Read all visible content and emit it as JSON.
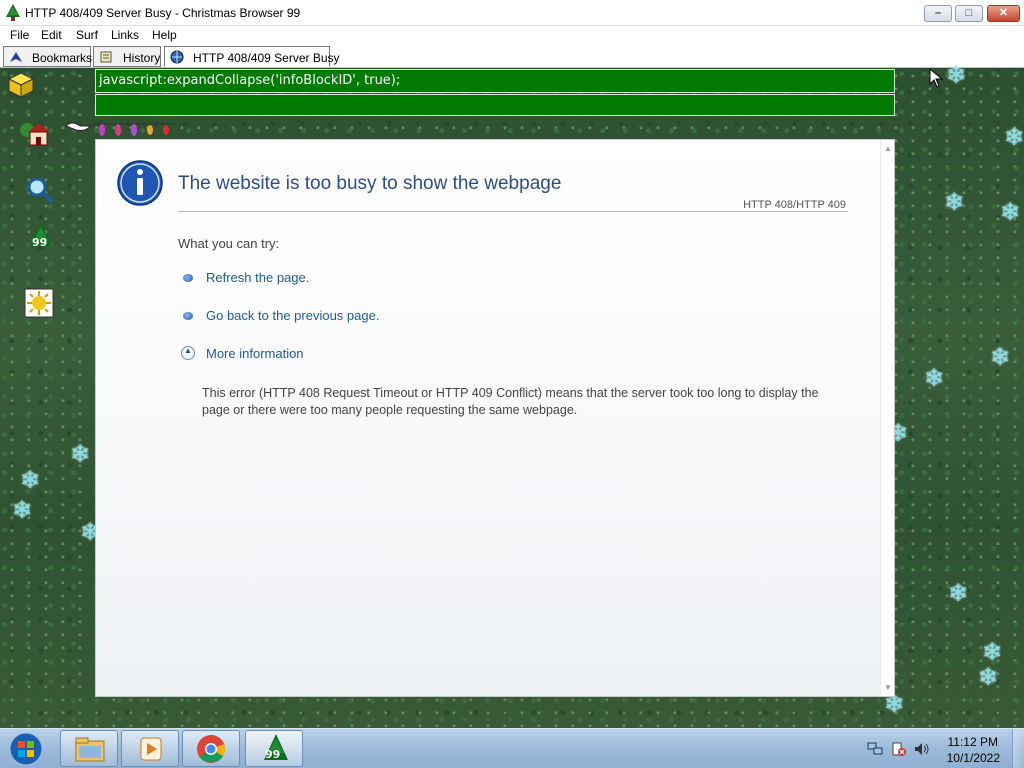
{
  "window": {
    "title": "HTTP 408/409 Server Busy - Christmas Browser 99",
    "controls": {
      "minimize": "–",
      "maximize": "□",
      "close": "✕"
    }
  },
  "menu": {
    "items": [
      "File",
      "Edit",
      "Surf",
      "Links",
      "Help"
    ]
  },
  "tabs": {
    "bookmarks": "Bookmarks",
    "history": "History",
    "active": "HTTP 408/409 Server Busy"
  },
  "address_bar": {
    "value": "javascript:expandCollapse('infoBlockID', true);"
  },
  "page": {
    "heading": "The website is too busy to show the webpage",
    "error_code": "HTTP 408/HTTP 409",
    "try_label": "What you can try:",
    "links": {
      "refresh": "Refresh the page.",
      "go_back": "Go back to the previous page.",
      "more_info": "More information"
    },
    "details": "This error (HTTP 408 Request Timeout or HTTP 409 Conflict) means that the server took too long to display the page or there were too many people requesting the same webpage."
  },
  "sidebar": {
    "items": [
      "box-icon",
      "home-icon",
      "search-icon",
      "tree-99-icon",
      "sun-icon"
    ],
    "tree_badge": "99"
  },
  "taskbar": {
    "clock_time": "11:12 PM",
    "clock_date": "10/1/2022",
    "christmas_badge": "99"
  },
  "colors": {
    "address_bg": "#007a00",
    "heading": "#2a4f86",
    "link": "#1e5b9c",
    "snowflake": "#7fe0ef"
  }
}
